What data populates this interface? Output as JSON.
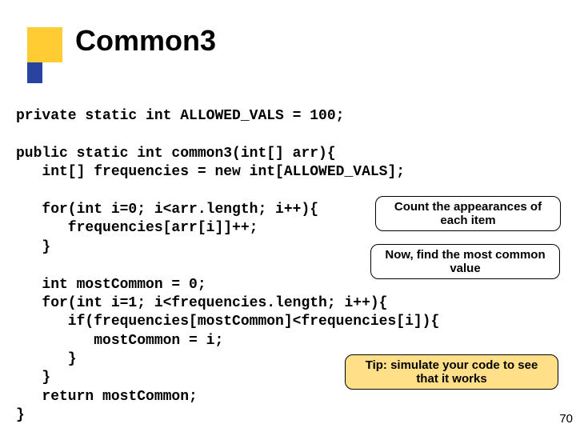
{
  "title": "Common3",
  "code": "private static int ALLOWED_VALS = 100;\n\npublic static int common3(int[] arr){\n   int[] frequencies = new int[ALLOWED_VALS];\n\n   for(int i=0; i<arr.length; i++){\n      frequencies[arr[i]]++;\n   }\n\n   int mostCommon = 0;\n   for(int i=1; i<frequencies.length; i++){\n      if(frequencies[mostCommon]<frequencies[i]){\n         mostCommon = i;\n      }\n   }\n   return mostCommon;\n}",
  "annotations": {
    "count_appearances": "Count the appearances of each item",
    "find_common": "Now, find the most common value",
    "tip": "Tip: simulate your code to see that it works"
  },
  "page_number": "70"
}
